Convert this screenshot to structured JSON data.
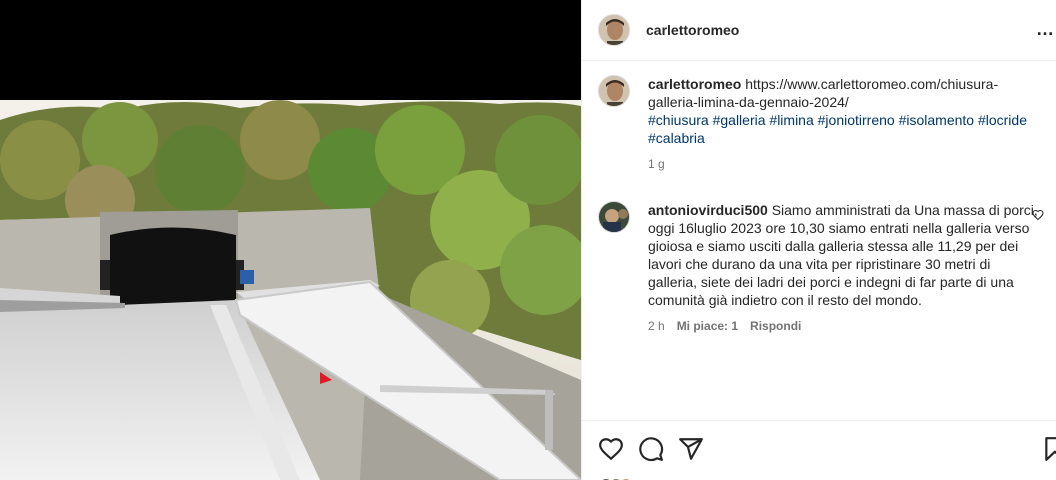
{
  "post": {
    "username": "carlettoromeo",
    "caption_user": "carlettoromeo",
    "caption_text": " https://www.carlettoromeo.com/chiusura-galleria-limina-da-gennaio-2024/",
    "hashtags": "#chiusura #galleria #limina #joniotirreno #isolamento #locride #calabria",
    "age": "1 g"
  },
  "comment": {
    "username": "antoniovirduci500",
    "text": " Siamo amministrati da Una massa di porci, oggi 16luglio 2023 ore 10,30 siamo entrati nella galleria verso gioiosa e siamo usciti dalla galleria stessa alle 11,29 per dei lavori che durano da una vita per ripristinare 30 metri di galleria, siete dei ladri dei porci e indegni di far parte di una comunità già indietro con il resto del mondo.",
    "age": "2 h",
    "likes": "Mi piace: 1",
    "reply": "Rispondi"
  },
  "icons": {
    "more": "more-options-icon",
    "like": "heart-icon",
    "comment": "comment-icon",
    "share": "share-icon",
    "save": "bookmark-icon"
  },
  "colors": {
    "text": "#262626",
    "secondary": "#737373",
    "link": "#00376b",
    "border": "#efefef"
  }
}
